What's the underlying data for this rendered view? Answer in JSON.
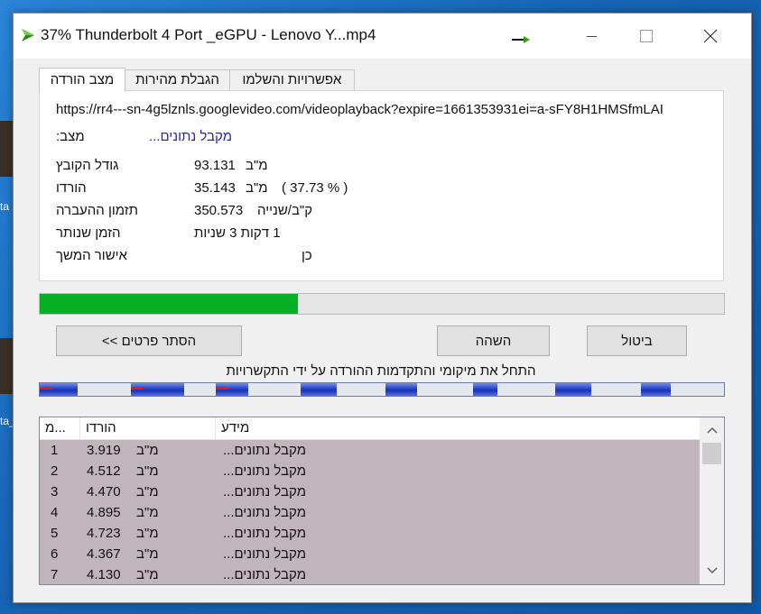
{
  "window": {
    "title": "37% Thunderbolt 4 Port _eGPU - Lenovo Y...mp4",
    "minimize_label": "–",
    "maximize_label": "☐",
    "close_label": "✕"
  },
  "desktop": {
    "label_1": "ta",
    "label_2": "ta_"
  },
  "tabs": [
    {
      "label": "מצב הורדה",
      "active": true
    },
    {
      "label": "הגבלת מהירות",
      "active": false
    },
    {
      "label": "אפשרויות והשלמו",
      "active": false
    }
  ],
  "info": {
    "url": "https://rr4---sn-4g5lznls.googlevideo.com/videoplayback?expire=1661353931ei=a-sFY8H1HMSfmLAI",
    "status_label": "מצב:",
    "status_value": "מקבל נתונים...",
    "file_size_label": "גודל הקובץ",
    "file_size_value": "93.131",
    "file_size_unit": "מ\"ב",
    "downloaded_label": "הורדו",
    "downloaded_value": "35.143",
    "downloaded_unit": "מ\"ב",
    "downloaded_percent": "( 37.73 % )",
    "transfer_rate_label": "תזמון ההעברה",
    "transfer_rate_value": "350.573",
    "transfer_rate_unit": "ק\"ב/שנייה",
    "time_left_label": "הזמן שנותר",
    "time_left_value": "1 דקות 3 שניות",
    "resume_label": "אישור המשך",
    "resume_value": "כן"
  },
  "progress": {
    "percent": 37.73
  },
  "buttons": {
    "hide_details": "הסתר פרטים >>",
    "pause": "השהה",
    "cancel": "ביטול"
  },
  "connections": {
    "text": "התחל את מיקומי והתקדמות ההורדה על ידי התקשרויות"
  },
  "list": {
    "headers": [
      "מ...",
      "הורדו",
      "מידע"
    ],
    "rows": [
      {
        "idx": "1",
        "downloaded": "3.919",
        "unit": "מ\"ב",
        "info": "מקבל נתונים..."
      },
      {
        "idx": "2",
        "downloaded": "4.512",
        "unit": "מ\"ב",
        "info": "מקבל נתונים..."
      },
      {
        "idx": "3",
        "downloaded": "4.470",
        "unit": "מ\"ב",
        "info": "מקבל נתונים..."
      },
      {
        "idx": "4",
        "downloaded": "4.895",
        "unit": "מ\"ב",
        "info": "מקבל נתונים..."
      },
      {
        "idx": "5",
        "downloaded": "4.723",
        "unit": "מ\"ב",
        "info": "מקבל נתונים..."
      },
      {
        "idx": "6",
        "downloaded": "4.367",
        "unit": "מ\"ב",
        "info": "מקבל נתונים..."
      },
      {
        "idx": "7",
        "downloaded": "4.130",
        "unit": "מ\"ב",
        "info": "מקבל נתונים..."
      }
    ]
  },
  "colors": {
    "progress_green": "#06b025",
    "status_blue": "#2222cc",
    "list_row_bg": "#c0b5bb",
    "segment_blue": "#2040c8",
    "segment_marker_red": "#d81c1c"
  }
}
